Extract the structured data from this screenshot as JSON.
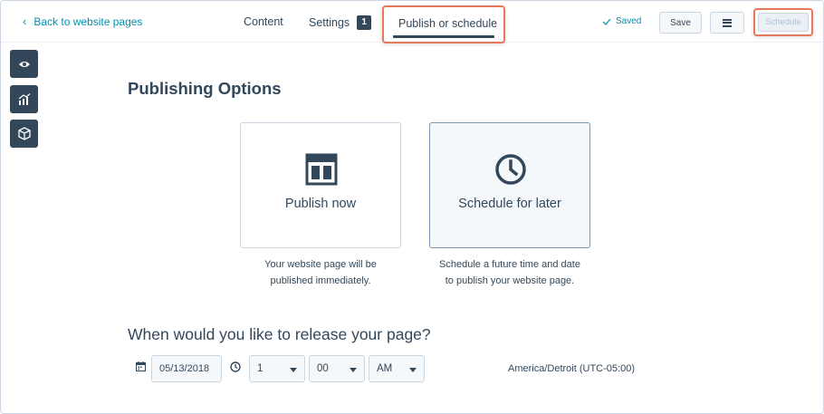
{
  "header": {
    "back_label": "Back to website pages",
    "tabs": {
      "content": "Content",
      "settings": "Settings",
      "settings_badge": "1",
      "publish": "Publish or schedule"
    },
    "saved_label": "Saved",
    "save_button": "Save",
    "schedule_button": "Schedule"
  },
  "side_tools": {
    "preview_icon": "eye-icon",
    "performance_icon": "chart-icon",
    "modules_icon": "cube-icon"
  },
  "main": {
    "heading": "Publishing Options",
    "options": [
      {
        "label": "Publish now",
        "description_line1": "Your website page will be",
        "description_line2": "published immediately.",
        "icon": "layout-icon"
      },
      {
        "label": "Schedule for later",
        "description_line1": "Schedule a future time and date",
        "description_line2": "to publish your website page.",
        "icon": "clock-icon"
      }
    ],
    "release_question": "When would you like to release your page?",
    "date_value": "05/13/2018",
    "hour_value": "1",
    "minute_value": "00",
    "ampm_value": "AM",
    "timezone": "America/Detroit (UTC-05:00)"
  },
  "colors": {
    "text": "#33475b",
    "link": "#0091ae",
    "highlight": "#e8785a",
    "border": "#cbd6e2",
    "panel": "#f5f8fa"
  }
}
